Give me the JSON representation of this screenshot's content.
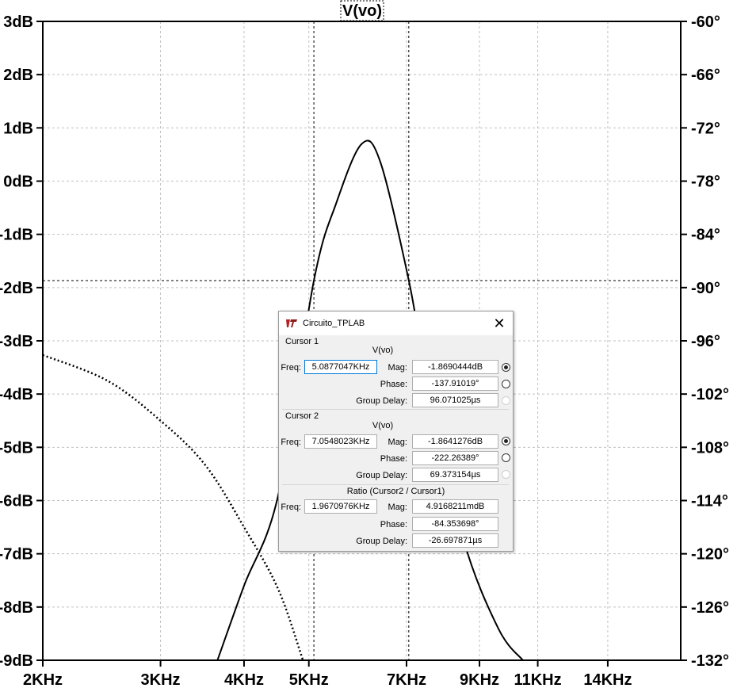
{
  "plot": {
    "trace_name": "V(vo)",
    "left_axis_labels": [
      "3dB",
      "2dB",
      "1dB",
      "0dB",
      "-1dB",
      "-2dB",
      "-3dB",
      "-4dB",
      "-5dB",
      "-6dB",
      "-7dB",
      "-8dB",
      "-9dB"
    ],
    "right_axis_labels": [
      "-60°",
      "-66°",
      "-72°",
      "-78°",
      "-84°",
      "-90°",
      "-96°",
      "-102°",
      "-108°",
      "-114°",
      "-120°",
      "-126°",
      "-132°"
    ],
    "x_axis_labels": [
      "2KHz",
      "3KHz",
      "4KHz",
      "5KHz",
      "7KHz",
      "9KHz",
      "11KHz",
      "14KHz"
    ],
    "x_axis_scale": "log",
    "magnitude_range_db": [
      -9,
      3
    ],
    "phase_range_deg": [
      -132,
      -60
    ],
    "cursor1_freq_khz": 5.0877047,
    "cursor2_freq_khz": 7.0548023,
    "cursor_level_db": -1.869,
    "grid": true
  },
  "chart_data": {
    "type": "line",
    "title": "V(vo)",
    "x_scale": "log",
    "xlim_khz": [
      2,
      18
    ],
    "ylim_db": [
      -9,
      3
    ],
    "y2lim_deg": [
      -132,
      -60
    ],
    "series": [
      {
        "name": "V(vo)",
        "axis": "left",
        "style": "solid",
        "x_khz": [
          3.65,
          4.0,
          4.5,
          5.0877,
          5.5,
          6.0,
          6.4,
          7.0548,
          7.5,
          8.5,
          9.6,
          10.45
        ],
        "y_db": [
          -9.0,
          -7.6,
          -5.9,
          -1.869,
          -0.4,
          0.7,
          0.35,
          -1.864,
          -3.7,
          -6.7,
          -8.4,
          -9.0
        ]
      },
      {
        "name": "V(vo)",
        "axis": "right",
        "style": "dotted",
        "x_khz": [
          2.0,
          2.5,
          3.0,
          3.5,
          4.0,
          4.5,
          4.9
        ],
        "y_deg": [
          -97.6,
          -100.5,
          -105.0,
          -110.0,
          -117.0,
          -124.0,
          -132.0
        ]
      }
    ]
  },
  "dialog": {
    "title": "Circuito_TPLAB",
    "close_symbol": "✕",
    "cursor1": {
      "heading": "Cursor 1",
      "signal": "V(vo)",
      "freq_label": "Freq:",
      "freq_value": "5.0877047KHz",
      "mag_label": "Mag:",
      "mag_value": "-1.8690444dB",
      "phase_label": "Phase:",
      "phase_value": "-137.91019°",
      "gd_label": "Group Delay:",
      "gd_value": "96.071025µs"
    },
    "cursor2": {
      "heading": "Cursor 2",
      "signal": "V(vo)",
      "freq_label": "Freq:",
      "freq_value": "7.0548023KHz",
      "mag_label": "Mag:",
      "mag_value": "-1.8641276dB",
      "phase_label": "Phase:",
      "phase_value": "-222.26389°",
      "gd_label": "Group Delay:",
      "gd_value": "69.373154µs"
    },
    "ratio": {
      "heading": "Ratio (Cursor2 / Cursor1)",
      "freq_label": "Freq:",
      "freq_value": "1.9670976KHz",
      "mag_label": "Mag:",
      "mag_value": "4.9168211mdB",
      "phase_label": "Phase:",
      "phase_value": "-84.353698°",
      "gd_label": "Group Delay:",
      "gd_value": "-26.697871µs"
    }
  }
}
